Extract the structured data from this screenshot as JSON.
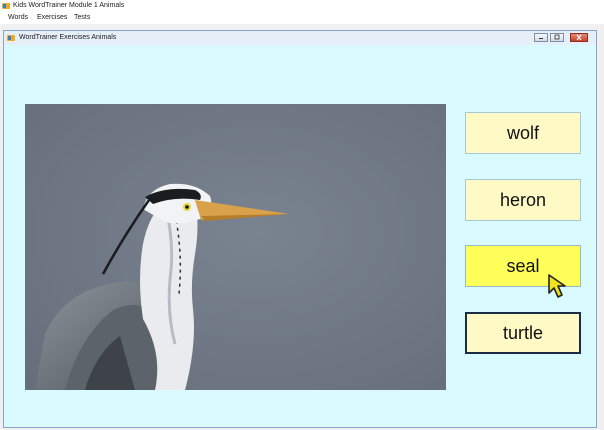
{
  "window": {
    "title": "Kids WordTrainer Module 1 Animals"
  },
  "menu": {
    "items": [
      {
        "label": "Words"
      },
      {
        "label": "Exercises"
      },
      {
        "label": "Tests"
      }
    ]
  },
  "child_window": {
    "title": "WordTrainer Exercises Animals",
    "buttons": [
      "minimize-icon",
      "maximize-icon",
      "close-icon"
    ]
  },
  "exercise": {
    "picture": "heron-photo",
    "answers": [
      {
        "label": "wolf",
        "state": "normal"
      },
      {
        "label": "heron",
        "state": "normal"
      },
      {
        "label": "seal",
        "state": "hover"
      },
      {
        "label": "turtle",
        "state": "focused"
      }
    ]
  },
  "colors": {
    "content_bg": "#d9fbff",
    "answer_bg": "#fff9c6",
    "answer_hover_bg": "#ffff5a",
    "photo_bg": "#717a86"
  }
}
